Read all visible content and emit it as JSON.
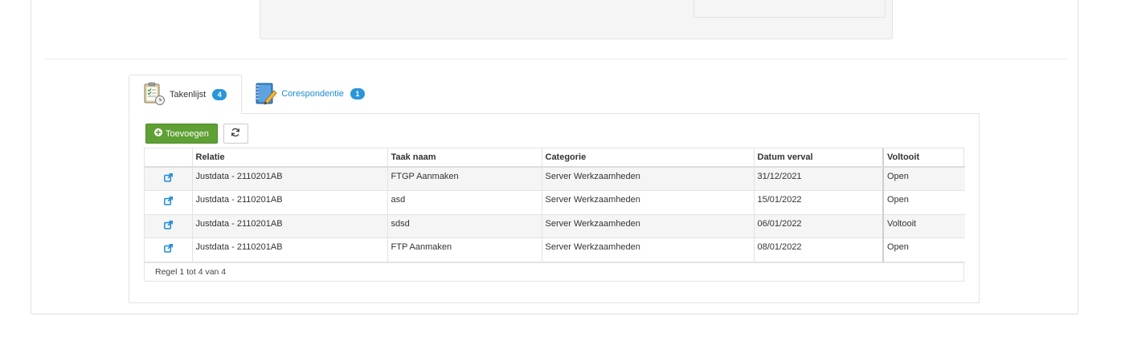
{
  "tabs": [
    {
      "label": "Takenlijst",
      "count": "4",
      "icon": "clipboard-icon"
    },
    {
      "label": "Corespondentie",
      "count": "1",
      "icon": "notebook-pencil-icon"
    }
  ],
  "toolbar": {
    "add_label": "Toevoegen",
    "add_icon": "plus-circle-icon",
    "refresh_icon": "refresh-icon"
  },
  "table": {
    "columns": [
      "",
      "Relatie",
      "Taak naam",
      "Categorie",
      "Datum verval",
      "Voltooit"
    ],
    "rows": [
      {
        "relatie": "Justdata - 2110201AB",
        "taak": "FTGP Aanmaken",
        "categorie": "Server Werkzaamheden",
        "datum": "31/12/2021",
        "voltooit": "Open"
      },
      {
        "relatie": "Justdata - 2110201AB",
        "taak": "asd",
        "categorie": "Server Werkzaamheden",
        "datum": "15/01/2022",
        "voltooit": "Open"
      },
      {
        "relatie": "Justdata - 2110201AB",
        "taak": "sdsd",
        "categorie": "Server Werkzaamheden",
        "datum": "06/01/2022",
        "voltooit": "Voltooit"
      },
      {
        "relatie": "Justdata - 2110201AB",
        "taak": "FTP Aanmaken",
        "categorie": "Server Werkzaamheden",
        "datum": "08/01/2022",
        "voltooit": "Open"
      }
    ],
    "row_link_icon": "external-link-icon"
  },
  "footer": {
    "info": "Regel 1 tot 4 van 4"
  },
  "colors": {
    "accent": "#1e8bd6",
    "badge": "#2a96d9",
    "add_button": "#5fa034"
  }
}
